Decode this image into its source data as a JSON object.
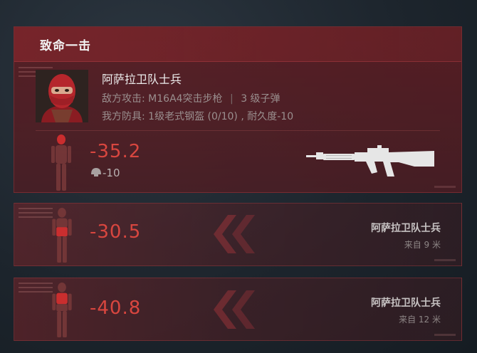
{
  "killshot": {
    "title": "致命一击",
    "enemy_name": "阿萨拉卫队士兵",
    "enemy_attack_label": "敌方攻击:",
    "enemy_weapon": "M16A4突击步枪",
    "ammo": "3 级子弹",
    "my_armor_label": "我方防具:",
    "my_armor": "1级老式钢盔 (0/10) , 耐久度-10",
    "damage": "-35.2",
    "armor_damage": "-10",
    "hit_zone": "head"
  },
  "hits": [
    {
      "damage": "-30.5",
      "attacker": "阿萨拉卫队士兵",
      "distance": "来自 9 米",
      "hit_zone": "stomach"
    },
    {
      "damage": "-40.8",
      "attacker": "阿萨拉卫队士兵",
      "distance": "来自 12 米",
      "hit_zone": "chest"
    }
  ],
  "icons": {
    "helmet": "helmet-icon",
    "rifle": "m16a4-rifle-icon",
    "body": "body-silhouette-icon",
    "chevron": "double-chevron-left-icon"
  },
  "colors": {
    "damage": "#d8463f",
    "panel": "#5f1c22",
    "hit_highlight": "#e03030"
  }
}
